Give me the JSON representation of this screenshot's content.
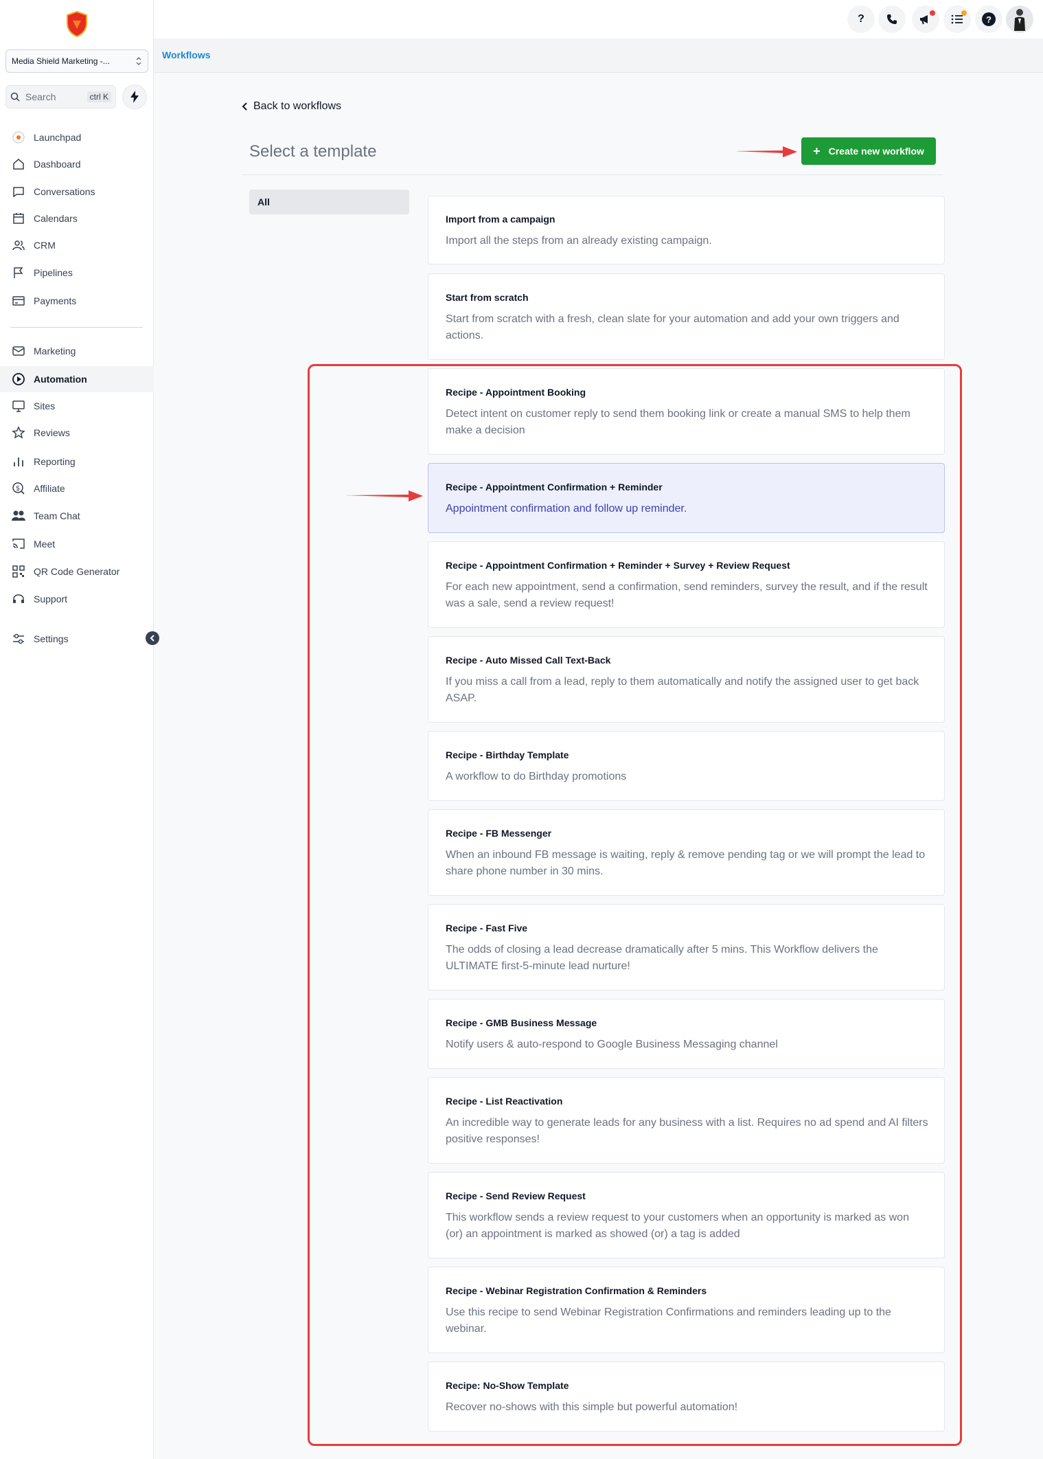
{
  "account": {
    "name": "Media Shield Marketing -..."
  },
  "search": {
    "label": "Search",
    "shortcut": "ctrl K"
  },
  "nav": {
    "launchpad": "Launchpad",
    "dashboard": "Dashboard",
    "conversations": "Conversations",
    "calendars": "Calendars",
    "crm": "CRM",
    "pipelines": "Pipelines",
    "payments": "Payments",
    "marketing": "Marketing",
    "automation": "Automation",
    "sites": "Sites",
    "reviews": "Reviews",
    "reporting": "Reporting",
    "affiliate": "Affiliate",
    "team_chat": "Team Chat",
    "meet": "Meet",
    "qr": "QR Code Generator",
    "support": "Support",
    "settings": "Settings"
  },
  "topbar": {
    "help_q": "?",
    "help_circle": "?"
  },
  "breadcrumb": "Workflows",
  "back_label": "Back to workflows",
  "page_title": "Select a template",
  "create_button": "Create new workflow",
  "filter": "All",
  "colors": {
    "accent_green": "#1d9b36",
    "link_blue": "#1a8ad3",
    "annotation_red": "#e53d3d",
    "highlight_bg": "#edf0fc"
  },
  "templates": [
    {
      "title": "Import from a campaign",
      "desc": "Import all the steps from an already existing campaign."
    },
    {
      "title": "Start from scratch",
      "desc": "Start from scratch with a fresh, clean slate for your automation and add your own triggers and actions."
    },
    {
      "title": "Recipe - Appointment Booking",
      "desc": "Detect intent on customer reply to send them booking link or create a manual SMS to help them make a decision"
    },
    {
      "title": "Recipe - Appointment Confirmation + Reminder",
      "desc": "Appointment confirmation and follow up reminder."
    },
    {
      "title": "Recipe - Appointment Confirmation + Reminder + Survey + Review Request",
      "desc": "For each new appointment, send a confirmation, send reminders, survey the result, and if the result was a sale, send a review request!"
    },
    {
      "title": "Recipe - Auto Missed Call Text-Back",
      "desc": "If you miss a call from a lead, reply to them automatically and notify the assigned user to get back ASAP."
    },
    {
      "title": "Recipe - Birthday Template",
      "desc": "A workflow to do Birthday promotions"
    },
    {
      "title": "Recipe - FB Messenger",
      "desc": "When an inbound FB message is waiting, reply & remove pending tag or we will prompt the lead to share phone number in 30 mins."
    },
    {
      "title": "Recipe - Fast Five",
      "desc": "The odds of closing a lead decrease dramatically after 5 mins. This Workflow delivers the ULTIMATE first-5-minute lead nurture!"
    },
    {
      "title": "Recipe - GMB Business Message",
      "desc": "Notify users & auto-respond to Google Business Messaging channel"
    },
    {
      "title": "Recipe - List Reactivation",
      "desc": "An incredible way to generate leads for any business with a list. Requires no ad spend and AI filters positive responses!"
    },
    {
      "title": "Recipe - Send Review Request",
      "desc": "This workflow sends a review request to your customers when an opportunity is marked as won (or) an appointment is marked as showed (or) a tag is added"
    },
    {
      "title": "Recipe - Webinar Registration Confirmation & Reminders",
      "desc": "Use this recipe to send Webinar Registration Confirmations and reminders leading up to the webinar."
    },
    {
      "title": "Recipe: No-Show Template",
      "desc": "Recover no-shows with this simple but powerful automation!"
    }
  ]
}
